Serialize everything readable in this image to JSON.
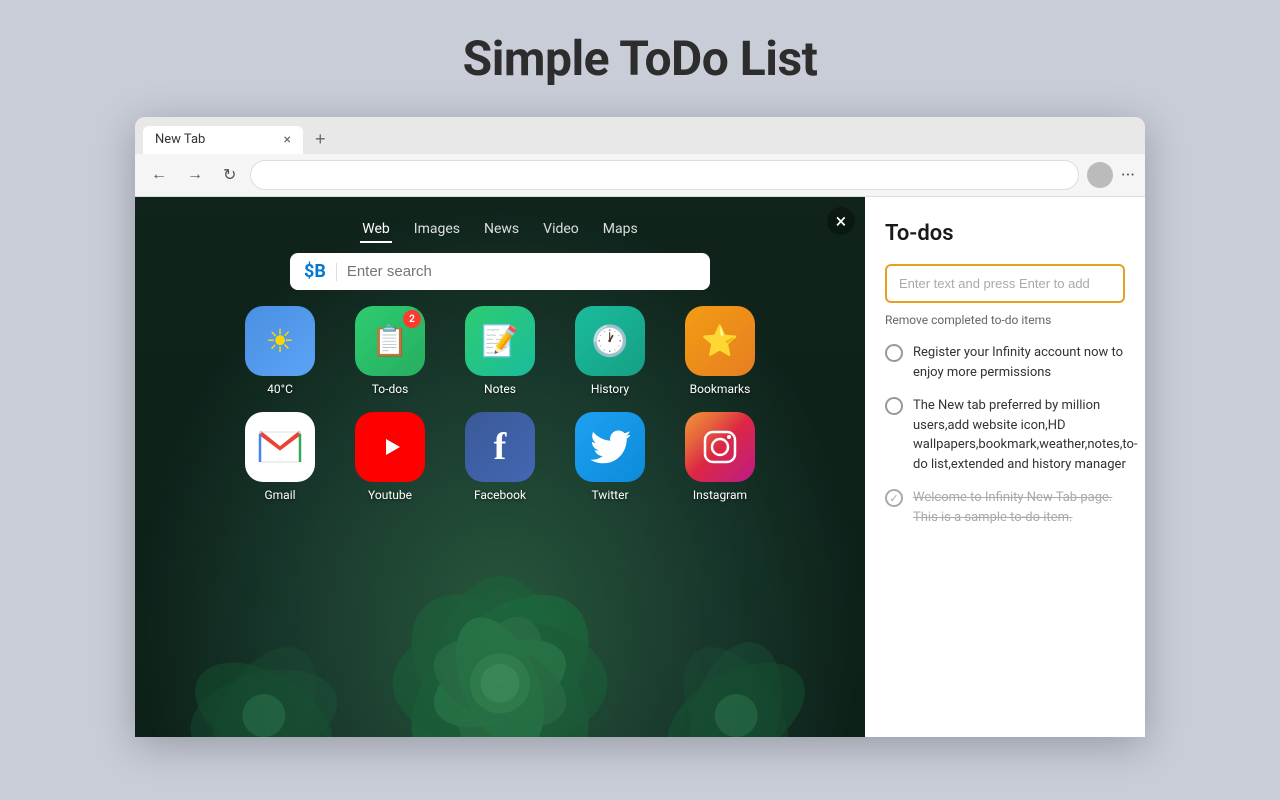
{
  "page": {
    "title": "Simple ToDo List"
  },
  "browser": {
    "tab_label": "New Tab",
    "address_bar_value": ""
  },
  "new_tab": {
    "search_tabs": [
      "Web",
      "Images",
      "News",
      "Video",
      "Maps"
    ],
    "active_search_tab": "Web",
    "search_placeholder": "Enter search",
    "close_label": "×"
  },
  "app_icons": [
    {
      "id": "weather",
      "label": "40°C",
      "style": "weather",
      "badge": null
    },
    {
      "id": "todos",
      "label": "To-dos",
      "style": "todos",
      "badge": "2"
    },
    {
      "id": "notes",
      "label": "Notes",
      "style": "notes",
      "badge": null
    },
    {
      "id": "history",
      "label": "History",
      "style": "history",
      "badge": null
    },
    {
      "id": "bookmarks",
      "label": "Bookmarks",
      "style": "bookmark",
      "badge": null
    },
    {
      "id": "gmail",
      "label": "Gmail",
      "style": "gmail",
      "badge": null
    },
    {
      "id": "youtube",
      "label": "Youtube",
      "style": "youtube",
      "badge": null
    },
    {
      "id": "facebook",
      "label": "Facebook",
      "style": "facebook",
      "badge": null
    },
    {
      "id": "twitter",
      "label": "Twitter",
      "style": "twitter",
      "badge": null
    },
    {
      "id": "instagram",
      "label": "Instagram",
      "style": "instagram",
      "badge": null
    }
  ],
  "todo_panel": {
    "title": "To-dos",
    "input_placeholder": "Enter text and press Enter to add",
    "remove_completed_label": "Remove completed to-do items",
    "items": [
      {
        "id": 1,
        "text": "Register your Infinity account now to enjoy more permissions",
        "completed": false
      },
      {
        "id": 2,
        "text": "The New tab preferred by million users,add website icon,HD wallpapers,bookmark,weather,notes,to-do list,extended and history manager",
        "completed": false
      },
      {
        "id": 3,
        "text": "Welcome to Infinity New Tab page. This is a sample to-do item.",
        "completed": true
      }
    ]
  }
}
